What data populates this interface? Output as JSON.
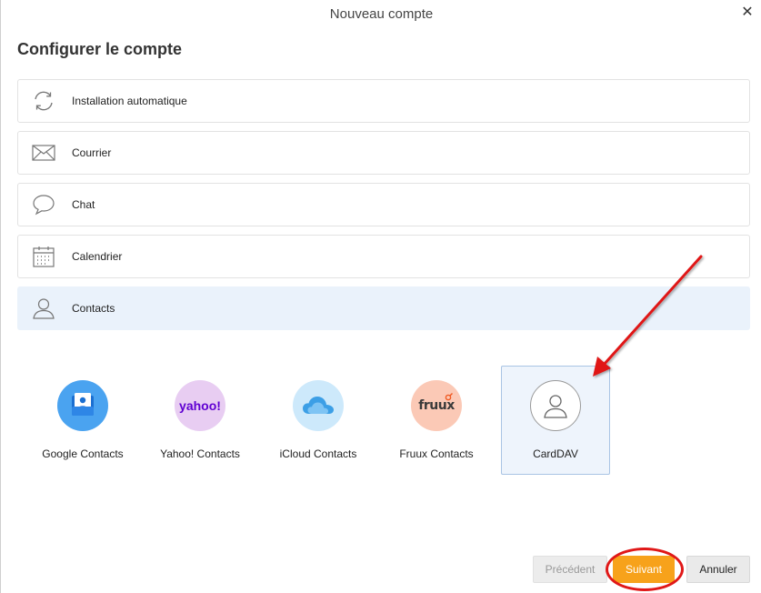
{
  "window": {
    "title": "Nouveau compte",
    "close_icon": "close-icon"
  },
  "heading": "Configurer le compte",
  "account_types": [
    {
      "id": "auto",
      "label": "Installation automatique",
      "icon": "sync-icon"
    },
    {
      "id": "mail",
      "label": "Courrier",
      "icon": "envelope-icon"
    },
    {
      "id": "chat",
      "label": "Chat",
      "icon": "chat-bubble-icon"
    },
    {
      "id": "calendar",
      "label": "Calendrier",
      "icon": "calendar-icon"
    },
    {
      "id": "contacts",
      "label": "Contacts",
      "icon": "person-icon",
      "selected": true
    }
  ],
  "providers": [
    {
      "id": "google",
      "label": "Google Contacts",
      "icon": "google-contacts-icon",
      "color": "#4aa3f0"
    },
    {
      "id": "yahoo",
      "label": "Yahoo! Contacts",
      "icon": "yahoo-icon",
      "logo_text": "yahoo!",
      "color": "#e8cdf2"
    },
    {
      "id": "icloud",
      "label": "iCloud Contacts",
      "icon": "icloud-icon",
      "color": "#cde9fb"
    },
    {
      "id": "fruux",
      "label": "Fruux Contacts",
      "icon": "fruux-icon",
      "logo_text": "fruux",
      "color": "#fbc9b6"
    },
    {
      "id": "carddav",
      "label": "CardDAV",
      "icon": "carddav-person-icon",
      "selected": true
    }
  ],
  "footer": {
    "prev_label": "Précédent",
    "next_label": "Suivant",
    "cancel_label": "Annuler"
  },
  "colors": {
    "accent": "#f7a21b",
    "selected_bg": "#eaf2fb",
    "annotation": "#e01818"
  }
}
